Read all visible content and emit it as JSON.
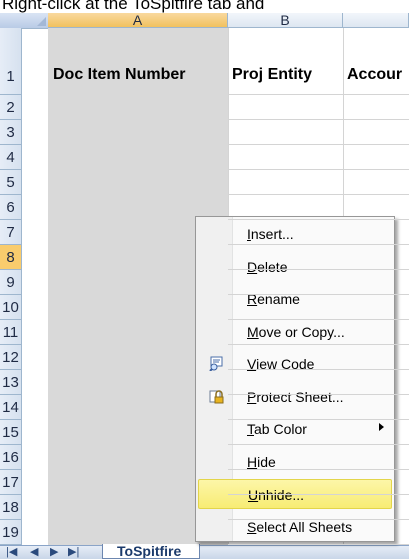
{
  "caption": "Right-click at the ToSpitfire tab and",
  "columns": {
    "a": "A",
    "b": "B"
  },
  "header_row": {
    "doc_item_number": "Doc Item Number",
    "proj_entity": "Proj Entity",
    "account": "Accour"
  },
  "rows": [
    "1",
    "2",
    "3",
    "4",
    "5",
    "6",
    "7",
    "8",
    "9",
    "10",
    "11",
    "12",
    "13",
    "14",
    "15",
    "16",
    "17",
    "18",
    "19"
  ],
  "active_row": "8",
  "sheet_tab": "ToSpitfire",
  "context_menu": {
    "items": [
      {
        "pre": "",
        "key": "I",
        "post": "nsert..."
      },
      {
        "pre": "",
        "key": "D",
        "post": "elete"
      },
      {
        "pre": "",
        "key": "R",
        "post": "ename"
      },
      {
        "pre": "",
        "key": "M",
        "post": "ove or Copy..."
      },
      {
        "pre": "",
        "key": "V",
        "post": "iew Code",
        "icon": "view-code-icon"
      },
      {
        "pre": "",
        "key": "P",
        "post": "rotect Sheet...",
        "icon": "protect-sheet-icon"
      },
      {
        "pre": "",
        "key": "T",
        "post": "ab Color",
        "submenu": true
      },
      {
        "pre": "",
        "key": "H",
        "post": "ide"
      },
      {
        "pre": "",
        "key": "U",
        "post": "nhide...",
        "highlighted": true
      },
      {
        "pre": "",
        "key": "S",
        "post": "elect All Sheets"
      }
    ]
  },
  "colors": {
    "highlight": "#f7ec74",
    "column_a_fill": "#d9d9d9",
    "active_row_header": "#f9cc6d"
  }
}
